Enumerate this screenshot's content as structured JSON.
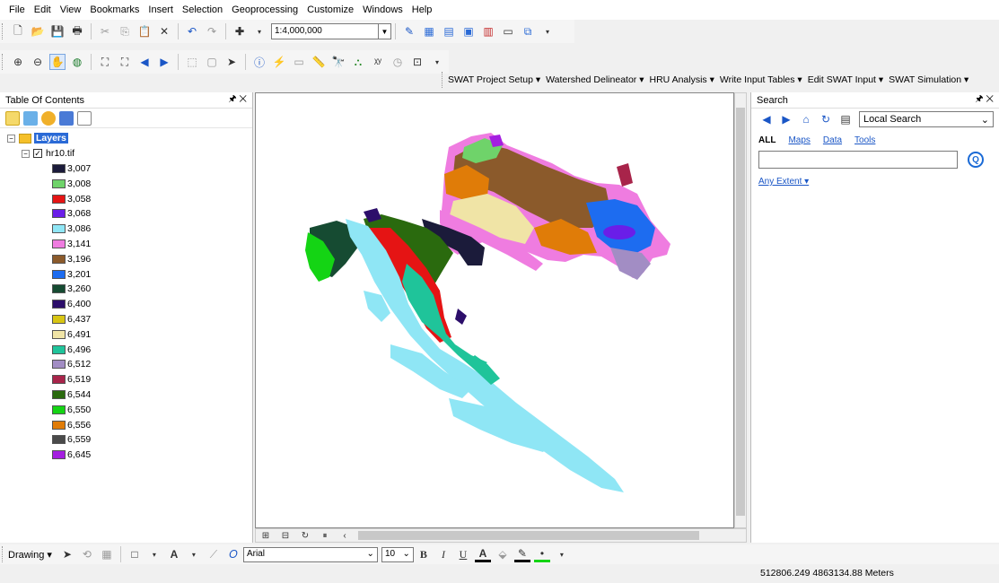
{
  "menu": [
    "File",
    "Edit",
    "View",
    "Bookmarks",
    "Insert",
    "Selection",
    "Geoprocessing",
    "Customize",
    "Windows",
    "Help"
  ],
  "standard_toolbar": {
    "scale": "1:4,000,000"
  },
  "swat_menu": [
    "SWAT Project Setup ▾",
    "Watershed Delineator ▾",
    "HRU Analysis ▾",
    "Write Input Tables ▾",
    "Edit SWAT Input ▾",
    "SWAT Simulation ▾"
  ],
  "toc": {
    "title": "Table Of Contents",
    "pin": "🖈 ✕",
    "layers_label": "Layers",
    "raster_label": "hr10.tif",
    "legend": [
      {
        "value": "3,007",
        "color": "#1b1b3a"
      },
      {
        "value": "3,008",
        "color": "#6fd36a"
      },
      {
        "value": "3,058",
        "color": "#e51414"
      },
      {
        "value": "3,068",
        "color": "#6a1ee8"
      },
      {
        "value": "3,086",
        "color": "#8fe6f5"
      },
      {
        "value": "3,141",
        "color": "#ef7ce0"
      },
      {
        "value": "3,196",
        "color": "#8b5a2b"
      },
      {
        "value": "3,201",
        "color": "#1d6cf0"
      },
      {
        "value": "3,260",
        "color": "#164b32"
      },
      {
        "value": "6,400",
        "color": "#2c0e6a"
      },
      {
        "value": "6,437",
        "color": "#d8c513"
      },
      {
        "value": "6,491",
        "color": "#f0e4a6"
      },
      {
        "value": "6,496",
        "color": "#1fc49a"
      },
      {
        "value": "6,512",
        "color": "#a28dc4"
      },
      {
        "value": "6,519",
        "color": "#a8244a"
      },
      {
        "value": "6,544",
        "color": "#2a6a0e"
      },
      {
        "value": "6,550",
        "color": "#14d414"
      },
      {
        "value": "6,556",
        "color": "#e07c08"
      },
      {
        "value": "6,559",
        "color": "#4a4a4a"
      },
      {
        "value": "6,645",
        "color": "#a41ee0"
      }
    ]
  },
  "search": {
    "title": "Search",
    "pin": "🖈 ✕",
    "scope": "Local Search",
    "tabs": {
      "all": "ALL",
      "maps": "Maps",
      "data": "Data",
      "tools": "Tools"
    },
    "extent": "Any Extent ▾"
  },
  "drawing": {
    "label": "Drawing ▾",
    "font": "Arial",
    "size": "10"
  },
  "status": {
    "coords": "512806.249  4863134.88 Meters"
  }
}
